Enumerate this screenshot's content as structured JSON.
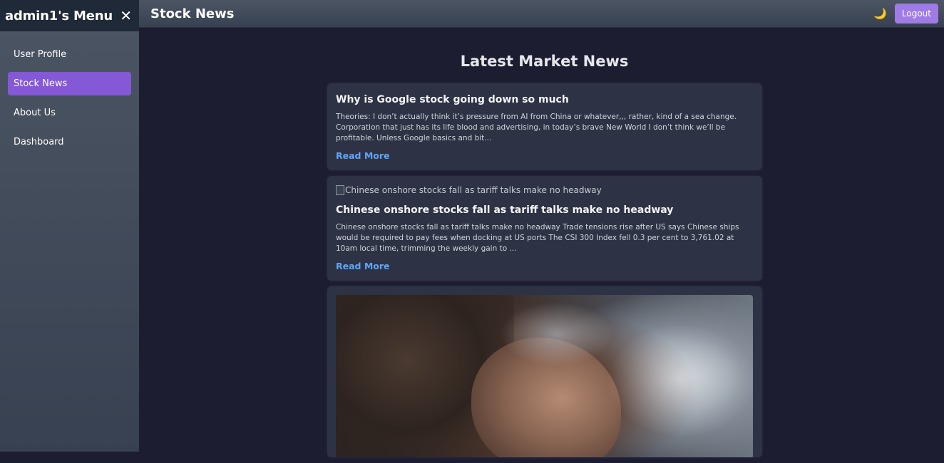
{
  "sidebar": {
    "title": "admin1's Menu",
    "close_icon": "close-icon",
    "items": [
      {
        "label": "User Profile",
        "active": false
      },
      {
        "label": "Stock News",
        "active": true
      },
      {
        "label": "About Us",
        "active": false
      },
      {
        "label": "Dashboard",
        "active": false
      }
    ]
  },
  "topbar": {
    "title": "Stock News",
    "theme_icon": "moon-icon",
    "logout_label": "Logout"
  },
  "main": {
    "heading": "Latest Market News",
    "articles": [
      {
        "title": "Why is Google stock going down so much",
        "description": "Theories: I don’t actually think it’s pressure from AI from China or whatever,,, rather, kind of a sea change. Corporation that just has its life blood and advertising, in today’s brave New World I don’t think we’ll be profitable. Unless Google basics and bit...",
        "link_label": "Read More"
      },
      {
        "image_alt": "Chinese onshore stocks fall as tariff talks make no headway",
        "title": "Chinese onshore stocks fall as tariff talks make no headway",
        "description": "Chinese onshore stocks fall as tariff talks make no headway Trade tensions rise after US says Chinese ships would be required to pay fees when docking at US ports The CSI 300 Index fell 0.3 per cent to 3,761.02 at 10am local time, trimming the weekly gain to ...",
        "link_label": "Read More"
      },
      {
        "image": "article-photo"
      }
    ]
  },
  "colors": {
    "accent": "#8458d6",
    "logout": "#a07be6",
    "link": "#60a5fa",
    "background": "#1c1d30",
    "card": "#2d3344"
  }
}
